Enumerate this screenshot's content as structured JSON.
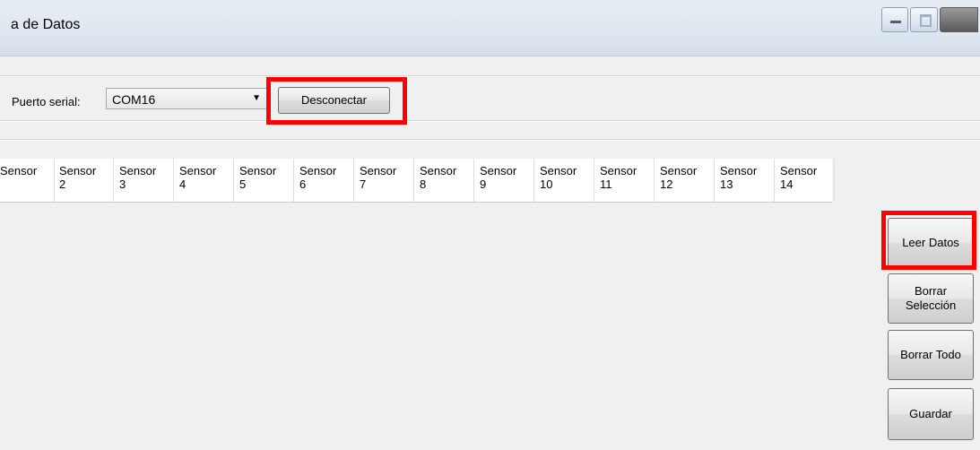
{
  "window": {
    "title": "a de Datos"
  },
  "connection": {
    "port_label": "Puerto serial:",
    "port_value": "COM16",
    "disconnect_label": "Desconectar"
  },
  "grid": {
    "columns": [
      {
        "line1": "Sensor",
        "line2": ""
      },
      {
        "line1": "Sensor",
        "line2": "2"
      },
      {
        "line1": "Sensor",
        "line2": "3"
      },
      {
        "line1": "Sensor",
        "line2": "4"
      },
      {
        "line1": "Sensor",
        "line2": "5"
      },
      {
        "line1": "Sensor",
        "line2": "6"
      },
      {
        "line1": "Sensor",
        "line2": "7"
      },
      {
        "line1": "Sensor",
        "line2": "8"
      },
      {
        "line1": "Sensor",
        "line2": "9"
      },
      {
        "line1": "Sensor",
        "line2": "10"
      },
      {
        "line1": "Sensor",
        "line2": "11"
      },
      {
        "line1": "Sensor",
        "line2": "12"
      },
      {
        "line1": "Sensor",
        "line2": "13"
      },
      {
        "line1": "Sensor",
        "line2": "14"
      }
    ]
  },
  "actions": {
    "read_label": "Leer Datos",
    "clear_selection_line1": "Borrar",
    "clear_selection_line2": "Selección",
    "clear_all_label": "Borrar Todo",
    "save_label": "Guardar"
  },
  "colors": {
    "highlight": "#ff0000",
    "background": "#f0f0f0"
  }
}
